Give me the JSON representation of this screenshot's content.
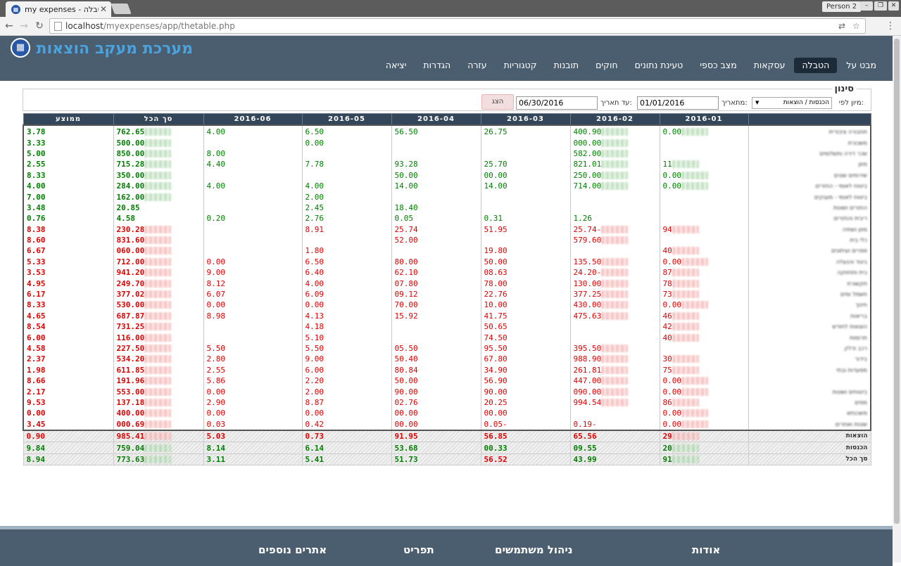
{
  "browser": {
    "tab_title": "my expenses - הטבלה",
    "profile": "Person 2",
    "url_host": "localhost",
    "url_path": "/myexpenses/app/thetable.php"
  },
  "app": {
    "title": "מערכת מעקב הוצאות",
    "nav": [
      "מבט על",
      "הטבלה",
      "עסקאות",
      "מצב כספי",
      "טעינת נתונים",
      "חוקים",
      "תובנות",
      "קטגוריות",
      "עזרה",
      "הגדרות",
      "יציאה"
    ],
    "active_nav": "הטבלה"
  },
  "filter": {
    "legend": "סינון",
    "sort_label": "מיון לפי:",
    "sort_value": "הכנסות / הוצאות",
    "from_label": "מתאריך:",
    "from_value": "01/01/2016",
    "to_label": "עד תאריך:",
    "to_value": "06/30/2016",
    "show_button": "הצג"
  },
  "table": {
    "columns": [
      "2016-01",
      "2016-02",
      "2016-03",
      "2016-04",
      "2016-05",
      "2016-06",
      "סך הכל",
      "ממוצע"
    ],
    "rows": [
      {
        "cat": "תחבורה ציבורית",
        "c": [
          "0.00",
          "400.90",
          "26.75",
          "56.50",
          "6.50",
          "4.00",
          "762.65",
          "3.78"
        ],
        "t": "p"
      },
      {
        "cat": "משכורת",
        "c": [
          "",
          "000.00",
          "",
          "",
          "0.00",
          "",
          "500.00",
          "3.33"
        ],
        "t": "p"
      },
      {
        "cat": "שכר דירה ותשלומים",
        "c": [
          "",
          "582.00",
          "",
          "",
          "",
          "8.00",
          "850.00",
          "5.00"
        ],
        "t": "p"
      },
      {
        "cat": "מזון",
        "c": [
          "11",
          "821.01",
          "25.70",
          "93.28",
          "7.78",
          "4.40",
          "715.28",
          "2.55"
        ],
        "t": "p"
      },
      {
        "cat": "שירותים שונים",
        "c": [
          "0.00",
          "250.00",
          "00.00",
          "50.00",
          "",
          "",
          "350.00",
          "8.33"
        ],
        "t": "p"
      },
      {
        "cat": "ביטוח לאומי - החזרים",
        "c": [
          "0.00",
          "714.00",
          "14.00",
          "14.00",
          "4.00",
          "4.00",
          "284.00",
          "4.00"
        ],
        "t": "p"
      },
      {
        "cat": "ביטוח לאומי - מענקים",
        "c": [
          "",
          "",
          "",
          "",
          "2.00",
          "",
          "162.00",
          "7.00"
        ],
        "t": "p"
      },
      {
        "cat": "החזרים ושונות",
        "c": [
          "",
          "",
          "",
          "18.40",
          "2.45",
          "",
          "20.85",
          "3.48"
        ],
        "t": "p"
      },
      {
        "cat": "ריבית והחזרים",
        "c": [
          "",
          "1.26",
          "0.31",
          "0.05",
          "2.76",
          "0.20",
          "4.58",
          "0.76"
        ],
        "t": "p"
      },
      {
        "cat": "מזון ושתיה",
        "c": [
          "94",
          "-25.74",
          "51.95",
          "25.74",
          "8.91",
          "",
          "230.28",
          "8.38"
        ],
        "t": "n"
      },
      {
        "cat": "כלי בית",
        "c": [
          "",
          "579.60",
          "",
          "52.00",
          "",
          "",
          "831.60",
          "8.60"
        ],
        "t": "n"
      },
      {
        "cat": "ספרים ועיתונים",
        "c": [
          "40",
          "",
          "19.80",
          "",
          "1.80",
          "",
          "060.00",
          "6.67"
        ],
        "t": "n"
      },
      {
        "cat": "ביגוד והנעלה",
        "c": [
          "0.00",
          "135.50",
          "50.00",
          "80.00",
          "6.50",
          "0.00",
          "712.00",
          "5.33"
        ],
        "t": "n"
      },
      {
        "cat": "בית ותחזוקה",
        "c": [
          "87",
          "-24.20",
          "08.63",
          "62.10",
          "6.40",
          "9.00",
          "941.20",
          "3.53"
        ],
        "t": "n"
      },
      {
        "cat": "תקשורת",
        "c": [
          "78",
          "130.00",
          "78.00",
          "07.80",
          "4.00",
          "8.12",
          "249.70",
          "4.95"
        ],
        "t": "n"
      },
      {
        "cat": "חשמל ומים",
        "c": [
          "73",
          "377.25",
          "22.76",
          "09.12",
          "6.09",
          "6.07",
          "377.02",
          "6.17"
        ],
        "t": "n"
      },
      {
        "cat": "חינוך",
        "c": [
          "0.00",
          "430.00",
          "10.00",
          "70.00",
          "0.00",
          "0.00",
          "530.00",
          "8.33"
        ],
        "t": "n"
      },
      {
        "cat": "בריאות",
        "c": [
          "46",
          "475.63",
          "41.75",
          "15.92",
          "4.13",
          "8.98",
          "687.87",
          "4.65"
        ],
        "t": "n"
      },
      {
        "cat": "הוצאות לחודש",
        "c": [
          "42",
          "",
          "50.65",
          "",
          "4.18",
          "",
          "731.25",
          "8.54"
        ],
        "t": "n"
      },
      {
        "cat": "תרומות",
        "c": [
          "40",
          "",
          "74.50",
          "",
          "5.10",
          "",
          "116.00",
          "6.00"
        ],
        "t": "n"
      },
      {
        "cat": "רכב ודלק",
        "c": [
          "",
          "395.50",
          "95.50",
          "05.50",
          "5.50",
          "5.50",
          "227.50",
          "4.58"
        ],
        "t": "n"
      },
      {
        "cat": "בידור",
        "c": [
          "30",
          "988.90",
          "67.80",
          "50.40",
          "9.00",
          "2.80",
          "534.20",
          "2.37"
        ],
        "t": "n"
      },
      {
        "cat": "מסעדות ובתי",
        "c": [
          "75",
          "261.81",
          "34.90",
          "80.84",
          "6.00",
          "2.55",
          "611.85",
          "1.98"
        ],
        "t": "n"
      },
      {
        "cat": "",
        "c": [
          "0.00",
          "447.00",
          "56.90",
          "50.00",
          "2.20",
          "5.86",
          "191.96",
          "8.66"
        ],
        "t": "n"
      },
      {
        "cat": "ביטוחים ושונות",
        "c": [
          "0.00",
          "090.00",
          "90.00",
          "90.00",
          "2.00",
          "0.00",
          "553.00",
          "2.17"
        ],
        "t": "n"
      },
      {
        "cat": "מסים",
        "c": [
          "86",
          "994.54",
          "20.25",
          "02.76",
          "8.87",
          "2.90",
          "137.18",
          "9.53"
        ],
        "t": "n"
      },
      {
        "cat": "משכנתא",
        "c": [
          "0.00",
          "",
          "00.00",
          "00.00",
          "0.00",
          "0.00",
          "400.00",
          "0.00"
        ],
        "t": "n"
      },
      {
        "cat": "שונות ואחרים",
        "c": [
          "0.00",
          "-0.19",
          "-0.05",
          "00.00",
          "0.42",
          "0.03",
          "000.69",
          "3.45"
        ],
        "t": "n"
      }
    ],
    "totals": [
      {
        "cat": "הוצאות",
        "c": [
          "29",
          "65.56",
          "56.85",
          "91.95",
          "0.73",
          "5.03",
          "985.41",
          "0.90"
        ],
        "t": "n"
      },
      {
        "cat": "הכנסות",
        "c": [
          "20",
          "09.55",
          "00.33",
          "53.68",
          "6.14",
          "8.14",
          "759.04",
          "9.84"
        ],
        "t": "p"
      },
      {
        "cat": "סך הכל",
        "c": [
          "91",
          "43.99",
          "56.52",
          "51.73",
          "5.41",
          "3.11",
          "773.63",
          "8.94"
        ],
        "t": "m"
      }
    ]
  },
  "footer": {
    "sections": [
      "אודות",
      "ניהול משתמשים",
      "תפריט",
      "אתרים נוספים"
    ]
  }
}
